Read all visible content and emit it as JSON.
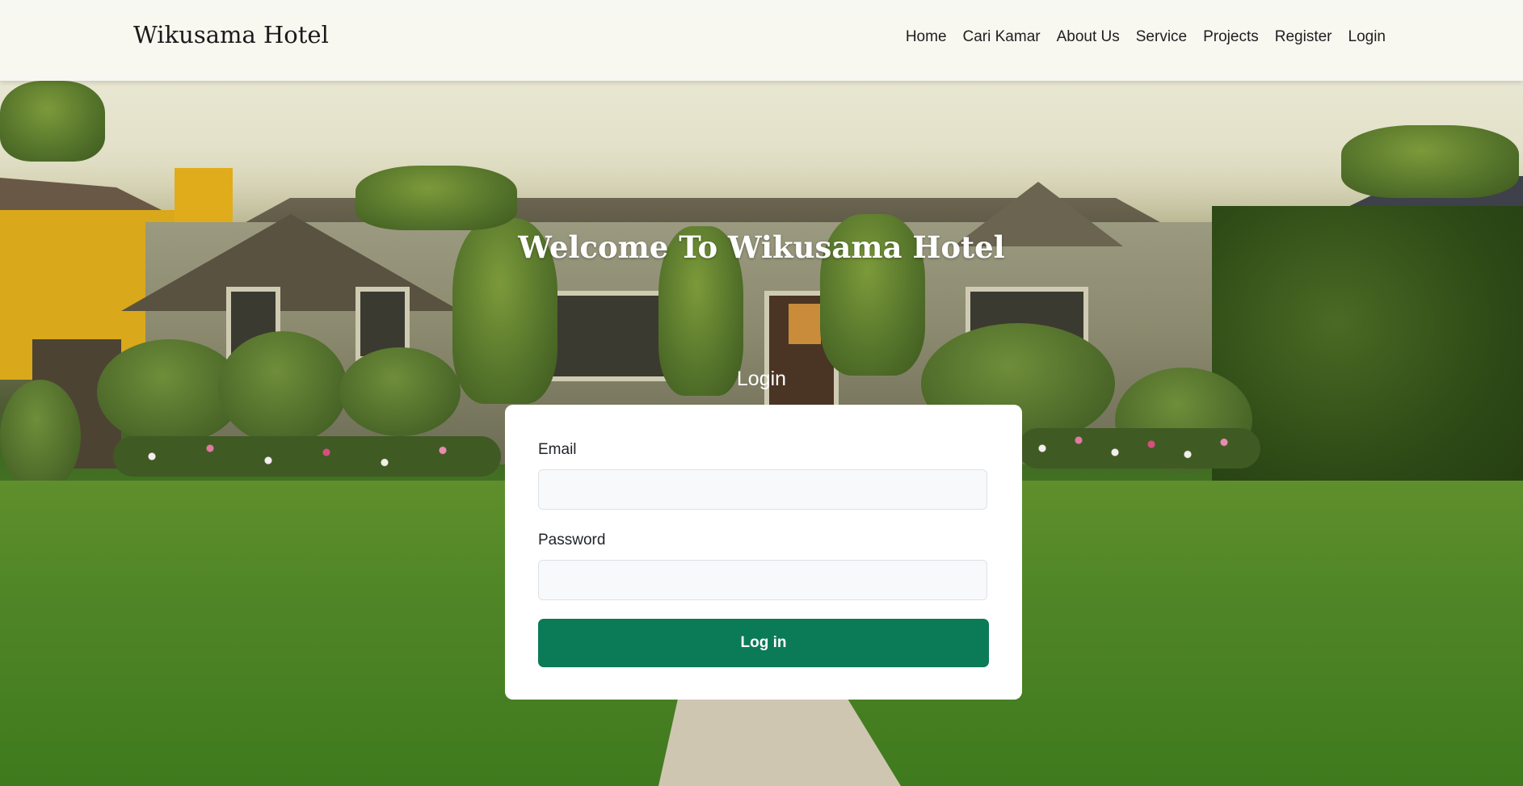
{
  "brand": "Wikusama Hotel",
  "nav": {
    "items": [
      {
        "label": "Home"
      },
      {
        "label": "Cari Kamar"
      },
      {
        "label": "About Us"
      },
      {
        "label": "Service"
      },
      {
        "label": "Projects"
      },
      {
        "label": "Register"
      },
      {
        "label": "Login"
      }
    ]
  },
  "hero": {
    "title": "Welcome To Wikusama Hotel"
  },
  "login_form": {
    "heading": "Login",
    "email_label": "Email",
    "email_value": "",
    "password_label": "Password",
    "password_value": "",
    "submit_label": "Log in"
  },
  "colors": {
    "accent": "#0b7a57",
    "navbar_bg": "#f8f8f3"
  }
}
